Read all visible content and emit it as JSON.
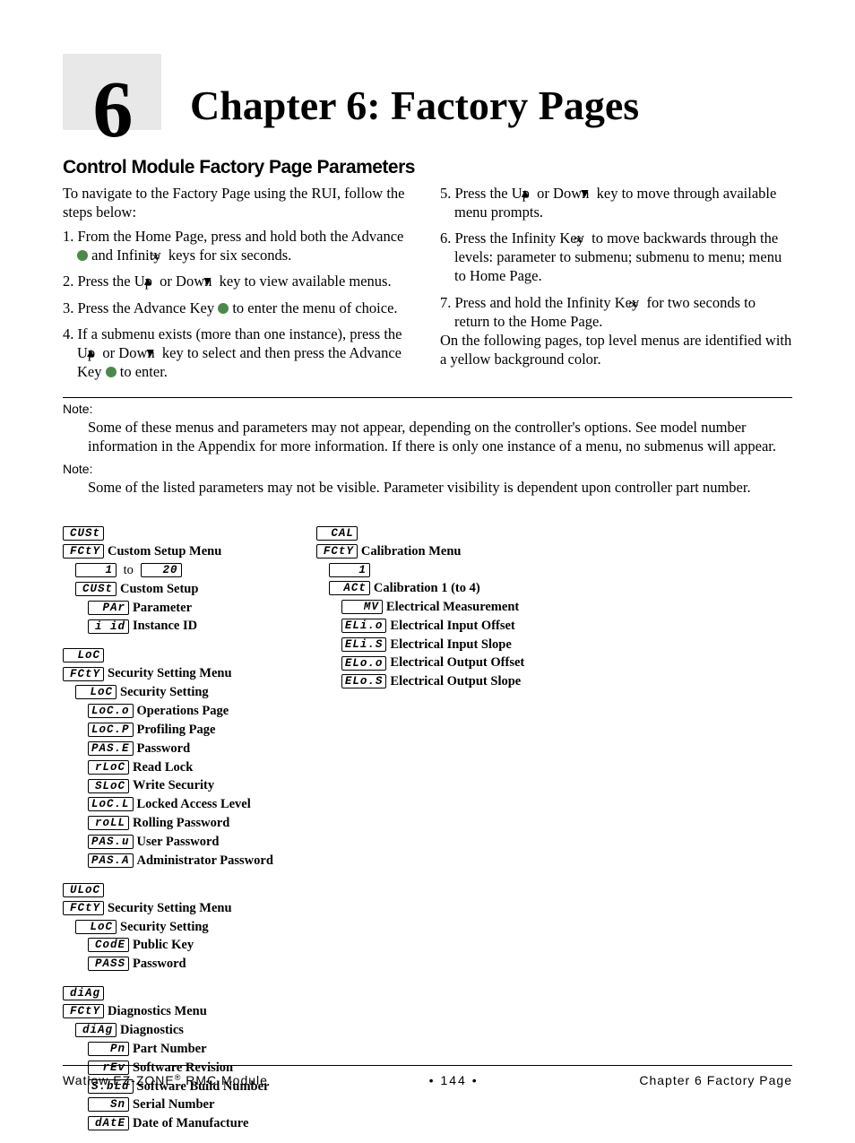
{
  "chapter": {
    "number": "6",
    "title": "Chapter 6: Factory Pages"
  },
  "section_heading": "Control Module Factory Page Parameters",
  "intro": "To navigate to the Factory Page using the RUI, follow the steps below:",
  "steps": {
    "s1_a": "From the Home Page, press and hold both the Advance ",
    "s1_b": " and Infinity ",
    "s1_c": " keys for six seconds.",
    "s2_a": "Press the Up ",
    "s2_b": " or Down ",
    "s2_c": " key to view available menus.",
    "s3_a": "Press the Advance Key ",
    "s3_b": " to enter the menu of choice.",
    "s4_a": "If a submenu exists (more than one instance), press the Up ",
    "s4_b": " or Down ",
    "s4_c": " key to select and then press the Advance Key ",
    "s4_d": " to enter.",
    "s5_a": "Press the Up ",
    "s5_b": " or Down ",
    "s5_c": " key to move through available menu prompts.",
    "s6_a": "Press the Infinity Key ",
    "s6_b": " to move backwards through the levels: parameter to submenu; submenu to menu; menu to Home Page.",
    "s7_a": "Press and hold the Infinity Key ",
    "s7_b": " for two seconds to return to the Home Page."
  },
  "outro": "On the following pages, top level menus are identified with a yellow background color.",
  "note_word": "Note:",
  "note1": "Some of these menus and parameters may not appear, depending on the controller's options. See model number information in the Appendix for more information. If there is only one instance of a menu, no submenus will appear.",
  "note2": "Some of the listed parameters may not be visible. Parameter visibility is dependent upon controller part number.",
  "icons": {
    "infinity": "∞",
    "up": "▲",
    "down": "▼"
  },
  "menus": {
    "col1": [
      {
        "top": [
          "CUSt",
          "FCtY"
        ],
        "top_label": "Custom Setup Menu",
        "range": {
          "from": "1",
          "to": "20"
        },
        "sub_code": "CUSt",
        "sub_label": "Custom Setup",
        "items": [
          {
            "code": "PAr",
            "label": "Parameter"
          },
          {
            "code": "i id",
            "label": "Instance ID"
          }
        ]
      },
      {
        "top": [
          "LoC",
          "FCtY"
        ],
        "top_label": "Security Setting Menu",
        "sub_code": "LoC",
        "sub_label": "Security Setting",
        "items": [
          {
            "code": "LoC.o",
            "label": "Operations Page"
          },
          {
            "code": "LoC.P",
            "label": "Profiling Page"
          },
          {
            "code": "PAS.E",
            "label": "Password"
          },
          {
            "code": "rLoC",
            "label": "Read Lock"
          },
          {
            "code": "SLoC",
            "label": "Write Security"
          },
          {
            "code": "LoC.L",
            "label": "Locked Access Level"
          },
          {
            "code": "roLL",
            "label": "Rolling Password"
          },
          {
            "code": "PAS.u",
            "label": "User Password"
          },
          {
            "code": "PAS.A",
            "label": "Administrator Password"
          }
        ]
      },
      {
        "top": [
          "ULoC",
          "FCtY"
        ],
        "top_label": "Security Setting Menu",
        "sub_code": "LoC",
        "sub_label": "Security Setting",
        "items": [
          {
            "code": "CodE",
            "label": "Public Key"
          },
          {
            "code": "PASS",
            "label": "Password"
          }
        ]
      },
      {
        "top": [
          "diAg",
          "FCtY"
        ],
        "top_label": "Diagnostics Menu",
        "sub_code": "diAg",
        "sub_label": "Diagnostics",
        "items": [
          {
            "code": "Pn",
            "label": "Part Number"
          },
          {
            "code": "rEv",
            "label": "Software Revision"
          },
          {
            "code": "S.bLd",
            "label": "Software Build Number"
          },
          {
            "code": "Sn",
            "label": "Serial Number"
          },
          {
            "code": "dAtE",
            "label": "Date of Manufacture"
          }
        ]
      }
    ],
    "col2": [
      {
        "top": [
          "CAL",
          "FCtY"
        ],
        "top_label": "Calibration Menu",
        "range": {
          "from": "1"
        },
        "sub_code": "ACt",
        "sub_label": "Calibration 1 (to 4)",
        "items": [
          {
            "code": "MV",
            "label": "Electrical Measurement"
          },
          {
            "code": "ELi.o",
            "label": "Electrical Input Offset"
          },
          {
            "code": "ELi.S",
            "label": "Electrical Input Slope"
          },
          {
            "code": "ELo.o",
            "label": "Electrical Output Offset"
          },
          {
            "code": "ELo.S",
            "label": "Electrical Output Slope"
          }
        ]
      }
    ]
  },
  "to_word": "to",
  "footer": {
    "left_a": "Watlow EZ-ZONE",
    "left_b": " RMC Module",
    "center": "•  144  •",
    "right": "Chapter 6 Factory Page",
    "reg": "®"
  }
}
